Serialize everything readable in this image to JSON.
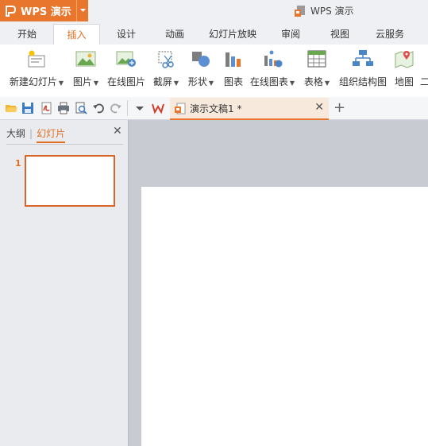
{
  "app": {
    "name": "WPS 演示",
    "window_title": "WPS 演示"
  },
  "colors": {
    "accent": "#e8762d",
    "active_tab_text": "#e06f21",
    "slide_border": "#d8652a"
  },
  "ribbon_tabs": [
    {
      "label": "开始"
    },
    {
      "label": "插入"
    },
    {
      "label": "设计"
    },
    {
      "label": "动画"
    },
    {
      "label": "幻灯片放映"
    },
    {
      "label": "审阅"
    },
    {
      "label": "视图"
    },
    {
      "label": "云服务"
    }
  ],
  "active_tab": "插入",
  "ribbon_buttons": [
    {
      "label": "新建幻灯片",
      "icon": "new-slide-icon",
      "dropdown": true
    },
    {
      "label": "图片",
      "icon": "picture-icon",
      "dropdown": true
    },
    {
      "label": "在线图片",
      "icon": "online-picture-icon",
      "dropdown": false
    },
    {
      "label": "截屏",
      "icon": "screenshot-icon",
      "dropdown": true
    },
    {
      "label": "形状",
      "icon": "shape-icon",
      "dropdown": true
    },
    {
      "label": "图表",
      "icon": "chart-icon",
      "dropdown": false
    },
    {
      "label": "在线图表",
      "icon": "online-chart-icon",
      "dropdown": true
    },
    {
      "label": "表格",
      "icon": "table-icon",
      "dropdown": true
    },
    {
      "label": "组织结构图",
      "icon": "org-chart-icon",
      "dropdown": false
    },
    {
      "label": "地图",
      "icon": "map-icon",
      "dropdown": false
    },
    {
      "label": "二",
      "icon": "",
      "dropdown": false
    }
  ],
  "document_tab": {
    "name": "演示文稿1 *"
  },
  "left_pane": {
    "outline_label": "大纲",
    "slides_label": "幻灯片",
    "slide_number": "1"
  }
}
